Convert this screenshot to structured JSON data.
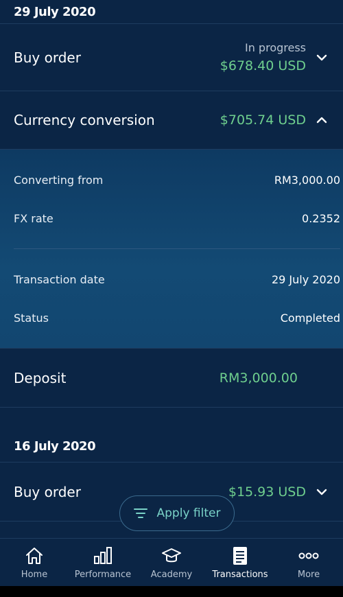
{
  "sections": [
    {
      "date": "29 July 2020"
    },
    {
      "date": "16 July 2020"
    }
  ],
  "transactions": {
    "buy_order_1": {
      "title": "Buy order",
      "status": "In progress",
      "amount": "$678.40 USD"
    },
    "currency_conversion": {
      "title": "Currency conversion",
      "amount": "$705.74 USD",
      "details": {
        "converting_from_label": "Converting from",
        "converting_from_value": "RM3,000.00",
        "fx_rate_label": "FX rate",
        "fx_rate_value": "0.2352",
        "transaction_date_label": "Transaction date",
        "transaction_date_value": "29 July 2020",
        "status_label": "Status",
        "status_value": "Completed"
      }
    },
    "deposit": {
      "title": "Deposit",
      "amount": "RM3,000.00"
    },
    "buy_order_2": {
      "title": "Buy order",
      "amount": "$15.93 USD"
    }
  },
  "filter": {
    "label": "Apply filter"
  },
  "nav": [
    {
      "label": "Home",
      "icon": "home-icon"
    },
    {
      "label": "Performance",
      "icon": "bar-chart-icon"
    },
    {
      "label": "Academy",
      "icon": "graduation-cap-icon"
    },
    {
      "label": "Transactions",
      "icon": "document-list-icon",
      "active": true
    },
    {
      "label": "More",
      "icon": "more-dots-icon"
    }
  ],
  "colors": {
    "background": "#0b2545",
    "accent_green": "#6fcf8e",
    "accent_teal": "#7ad3c8"
  }
}
